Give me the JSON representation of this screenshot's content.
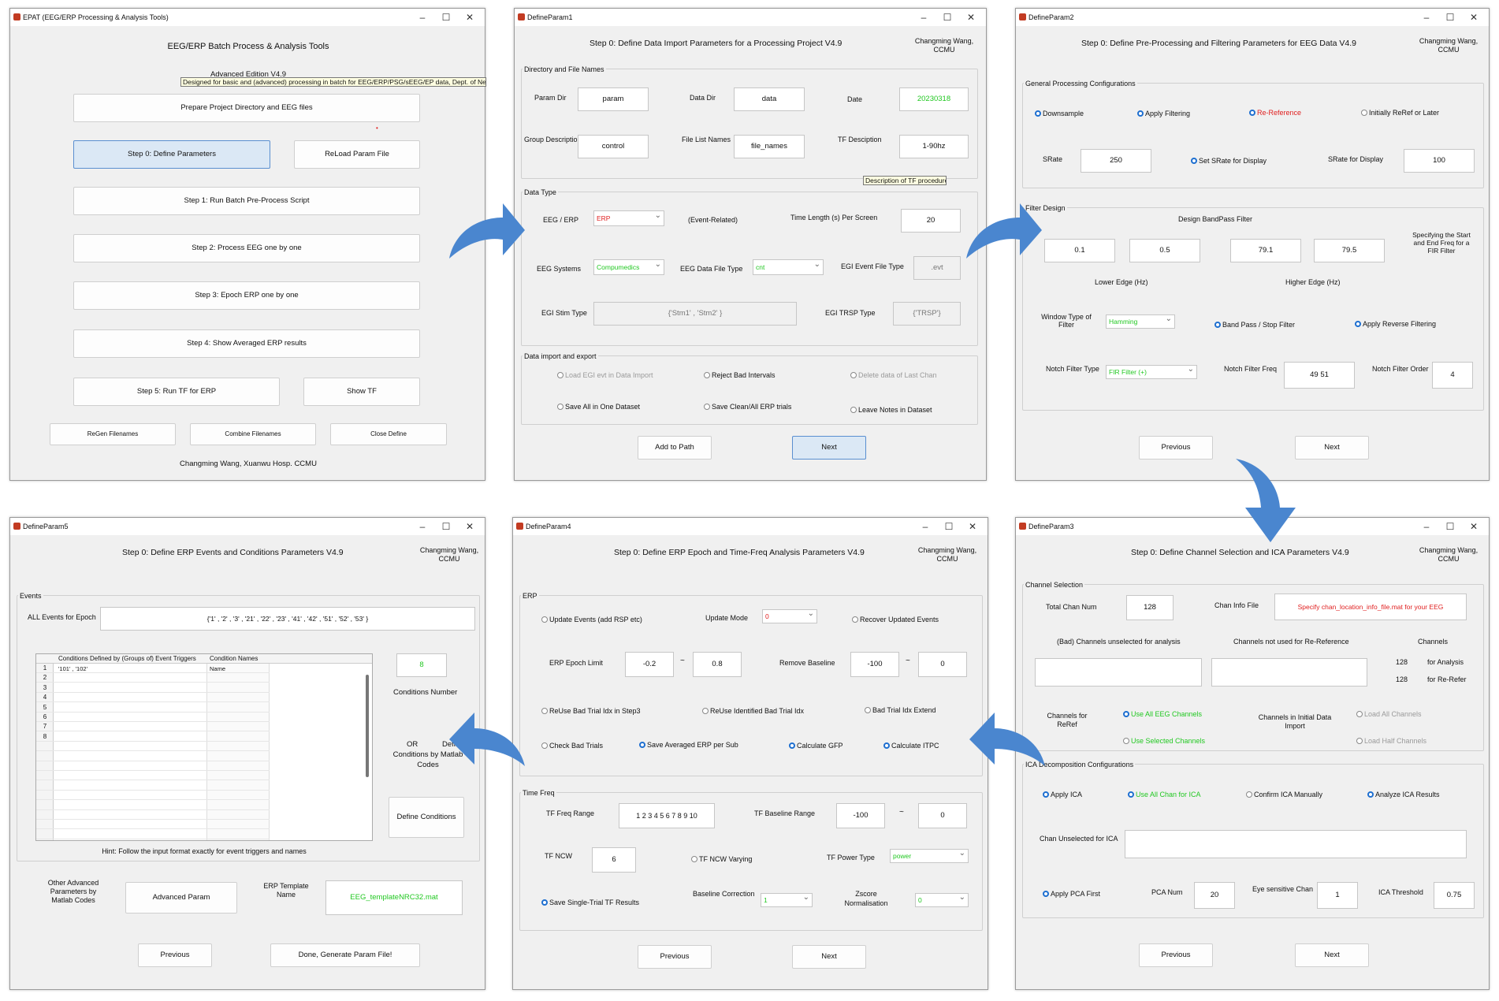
{
  "arrow_color": "#4a86cf",
  "win0": {
    "title": "EPAT (EEG/ERP Processing & Analysis Tools)",
    "heading": "EEG/ERP Batch Process & Analysis Tools",
    "edition": "Advanced Edition   V4.9",
    "tooltip": "Designed for basic and (advanced) processing in batch for EEG/ERP/PSG/sEEG/EP data, Dept. of Neurosurg",
    "btn_prepare": "Prepare Project Directory and EEG files",
    "btn_step0": "Step 0:  Define Parameters",
    "btn_reload": "ReLoad Param File",
    "btn_step1": "Step 1: Run Batch Pre-Process Script",
    "btn_step2": "Step 2: Process EEG one by one",
    "btn_step3": "Step 3: Epoch ERP one by one",
    "btn_step4": "Step 4: Show Averaged ERP results",
    "btn_step5": "Step 5: Run TF for ERP",
    "btn_showtf": "Show TF",
    "btn_regen": "ReGen Filenames",
    "btn_combine": "Combine Filenames",
    "btn_close": "Close Define",
    "footer": "Changming Wang, Xuanwu Hosp. CCMU"
  },
  "win1": {
    "title": "DefineParam1",
    "heading": "Step 0:  Define Data Import Parameters for a Processing Project     V4.9",
    "author1": "Changming Wang,",
    "author2": "CCMU",
    "grp_dir": "Directory and File Names",
    "param_dir_lbl": "Param Dir",
    "param_dir": "param",
    "data_dir_lbl": "Data Dir",
    "data_dir": "data",
    "date_lbl": "Date",
    "date": "20230318",
    "group_lbl": "Group Description",
    "group": "control",
    "filelist_lbl": "File List Names",
    "filelist": "file_names",
    "tfdesc_lbl": "TF Desciption",
    "tfdesc": "1-90hz",
    "tf_tip": "Description of TF procedure",
    "grp_type": "Data Type",
    "eegerp_lbl": "EEG / ERP",
    "eegerp": "ERP",
    "event_related": "(Event-Related)",
    "timelen_lbl": "Time Length (s) Per Screen",
    "timelen": "20",
    "sys_lbl": "EEG Systems",
    "sys": "Compumedics",
    "ftype_lbl": "EEG Data File Type",
    "ftype": "cnt",
    "egiev_lbl": "EGI Event File Type",
    "egiev": ".evt",
    "stim_lbl": "EGI Stim Type",
    "stim": "{'Stm1' , 'Stm2' }",
    "trsp_lbl": "EGI TRSP Type",
    "trsp": "{'TRSP'}",
    "grp_imp": "Data import and export",
    "opt_load": "Load EGI evt in Data Import",
    "opt_reject": "Reject Bad Intervals",
    "opt_delete": "Delete data of Last Chan",
    "opt_saveall": "Save All in One Dataset",
    "opt_saveclean": "Save Clean/All ERP trials",
    "opt_leave": "Leave Notes in Dataset",
    "btn_add": "Add to Path",
    "btn_next": "Next"
  },
  "win2": {
    "title": "DefineParam2",
    "heading": "Step 0:  Define Pre-Processing and Filtering Parameters for EEG Data     V4.9",
    "author1": "Changming Wang,",
    "author2": "CCMU",
    "grp_gen": "General Processing Configurations",
    "r_down": "Downsample",
    "r_filter": "Apply Filtering",
    "r_reref": "Re-Reference",
    "r_init": "Initially ReRef or Later",
    "srate_lbl": "SRate",
    "srate": "250",
    "r_setsrate": "Set SRate for Display",
    "srate_disp_lbl": "SRate for Display",
    "srate_disp": "100",
    "grp_filter": "Filter Design",
    "bandpass": "Design BandPass Filter",
    "f1": "0.1",
    "f2": "0.5",
    "f3": "79.1",
    "f4": "79.5",
    "spec": [
      "Specifying the Start",
      "and End Freq for a",
      "FIR Filter"
    ],
    "lower": "Lower Edge (Hz)",
    "higher": "Higher Edge (Hz)",
    "wtype_lbl1": "Window Type of",
    "wtype_lbl2": "Filter",
    "wtype": "Hamming",
    "r_bandpass": "Band Pass / Stop Filter",
    "r_reverse": "Apply Reverse Filtering",
    "notch_type_lbl": "Notch Filter Type",
    "notch_type": "FIR Filter (+)",
    "notch_freq_lbl": "Notch Filter Freq",
    "notch_freq": "49  51",
    "notch_order_lbl": "Notch Filter Order",
    "notch_order": "4",
    "btn_prev": "Previous",
    "btn_next": "Next"
  },
  "win3": {
    "title": "DefineParam3",
    "heading": "Step 0:  Define Channel Selection and ICA Parameters     V4.9",
    "author1": "Changming Wang,",
    "author2": "CCMU",
    "grp_chan": "Channel Selection",
    "total_lbl": "Total Chan Num",
    "total": "128",
    "info_lbl": "Chan Info File",
    "info": "Specify chan_location_info_file.mat for your EEG",
    "bad_lbl": "(Bad) Channels unselected for analysis",
    "notused_lbl": "Channels not used for Re-Reference",
    "ch_lbl": "Channels",
    "n_analysis": "128",
    "for_analysis": "for Analysis",
    "n_reref": "128",
    "for_reref": "for Re-Refer",
    "chreref1": "Channels for",
    "chreref2": "ReRef",
    "r_useall": "Use All EEG Channels",
    "r_usesel": "Use Selected Channels",
    "init1": "Channels in Initial Data",
    "init2": "Import",
    "r_loadall": "Load All Channels",
    "r_loadhalf": "Load Half Channels",
    "grp_ica": "ICA Decomposition Configurations",
    "r_applyica": "Apply ICA",
    "r_useallica": "Use All Chan for ICA",
    "r_confirm": "Confirm ICA Manually",
    "r_analyze": "Analyze ICA Results",
    "unsel_lbl": "Chan Unselected for ICA",
    "r_pca": "Apply PCA First",
    "pcanum_lbl": "PCA Num",
    "pcanum": "20",
    "eye_lbl": "Eye sensitive Chan",
    "eye": "1",
    "thr_lbl": "ICA Threshold",
    "thr": "0.75",
    "btn_prev": "Previous",
    "btn_next": "Next"
  },
  "win4": {
    "title": "DefineParam4",
    "heading": "Step 0:  Define ERP Epoch and Time-Freq Analysis Parameters     V4.9",
    "author1": "Changming Wang,",
    "author2": "CCMU",
    "grp_erp": "ERP",
    "r_update": "Update Events (add RSP etc)",
    "mode_lbl": "Update Mode",
    "mode": "0",
    "r_recover": "Recover Updated Events",
    "epoch_lbl": "ERP Epoch Limit",
    "epoch1": "-0.2",
    "tilde": "~",
    "epoch2": "0.8",
    "base_lbl": "Remove Baseline",
    "base1": "-100",
    "base2": "0",
    "r_reuse3": "ReUse Bad Trial Idx in Step3",
    "r_reuseid": "ReUse Identified Bad Trial Idx",
    "r_extend": "Bad Trial Idx Extend",
    "r_check": "Check Bad Trials",
    "r_saveavg": "Save Averaged ERP per Sub",
    "r_gfp": "Calculate GFP",
    "r_itpc": "Calculate ITPC",
    "grp_tf": "Time Freq",
    "tffreq_lbl": "TF Freq Range",
    "tffreq": "1  2  3  4  5  6  7  8  9  10",
    "tfbase_lbl": "TF Baseline Range",
    "tfbase1": "-100",
    "tfbase2": "0",
    "ncw_lbl": "TF NCW",
    "ncw": "6",
    "r_ncw": "TF NCW Varying",
    "power_lbl": "TF Power Type",
    "power": "power",
    "r_single": "Save Single-Trial TF Results",
    "bc_lbl": "Baseline Correction",
    "bc": "1",
    "z1": "Zscore",
    "z2": "Normalisation",
    "z": "0",
    "btn_prev": "Previous",
    "btn_next": "Next"
  },
  "win5": {
    "title": "DefineParam5",
    "heading": "Step 0:  Define ERP Events and Conditions Parameters     V4.9",
    "author1": "Changming Wang,",
    "author2": "CCMU",
    "grp_ev": "Events",
    "all_lbl": "ALL Events for Epoch",
    "all": "{'1' , '2' , '3' , '21' , '22' , '23' , '41' , '42' , '51' , '52' , '53' }",
    "col1": "Conditions Defined by (Groups of) Event Triggers",
    "col2": "Condition Names",
    "rows": [
      "1",
      "2",
      "3",
      "4",
      "5",
      "6",
      "7",
      "8"
    ],
    "row1_c1": "'101' , '102'",
    "row1_c2": "Name",
    "condnum": "8",
    "condnum_lbl": "Conditions Number",
    "or": "OR",
    "define": "Define",
    "define2": "Conditions by Matlab",
    "define3": "Codes",
    "btn_define": "Define Conditions",
    "hint": "Hint: Follow the input format exactly for event triggers and names",
    "other1": "Other Advanced",
    "other2": "Parameters by",
    "other3": "Matlab Codes",
    "btn_adv": "Advanced Param",
    "tmpl1": "ERP Template",
    "tmpl2": "Name",
    "tmpl": "EEG_templateNRC32.mat",
    "btn_prev": "Previous",
    "btn_done": "Done,  Generate Param File!"
  }
}
